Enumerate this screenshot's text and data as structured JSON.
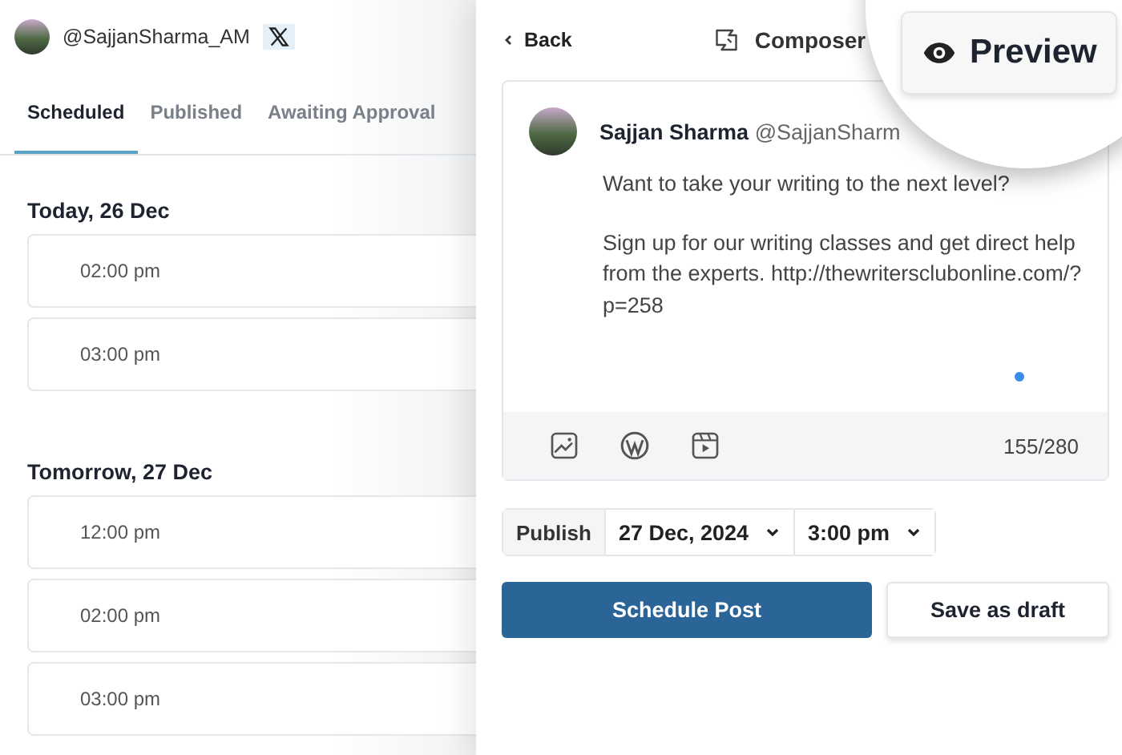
{
  "account": {
    "handle": "@SajjanSharma_AM"
  },
  "tabs": [
    {
      "label": "Scheduled",
      "selected": true
    },
    {
      "label": "Published",
      "selected": false
    },
    {
      "label": "Awaiting Approval",
      "selected": false
    }
  ],
  "days": [
    {
      "title": "Today, 26 Dec",
      "slots": [
        "02:00 pm",
        "03:00 pm"
      ]
    },
    {
      "title": "Tomorrow, 27 Dec",
      "slots": [
        "12:00 pm",
        "02:00 pm",
        "03:00 pm"
      ]
    }
  ],
  "composer": {
    "back": "Back",
    "title": "Composer",
    "preview": "Preview",
    "author": {
      "name": "Sajjan Sharma",
      "handle": "@SajjanSharm"
    },
    "paragraphs": [
      "Want to take your writing to the next level?",
      "Sign up for our writing classes and get direct help from the experts. http://thewritersclubonline.com/?p=258"
    ],
    "counter": "155/280",
    "publish": {
      "label": "Publish",
      "date": "27 Dec, 2024",
      "time": "3:00 pm"
    },
    "buttons": [
      {
        "label": "Schedule Post",
        "kind": "primary"
      },
      {
        "label": "Save as draft",
        "kind": "secondary"
      }
    ]
  }
}
